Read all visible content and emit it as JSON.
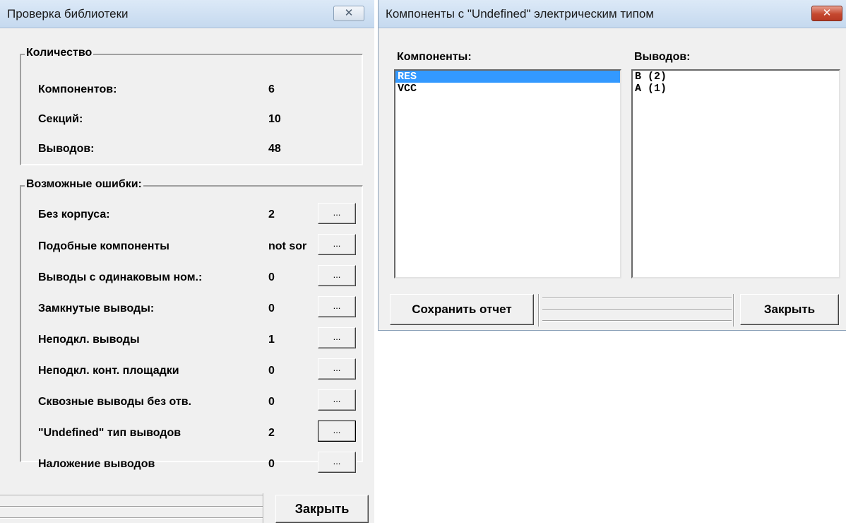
{
  "library_check": {
    "title": "Проверка библиотеки",
    "close_glyph": "✕",
    "quantity_group": {
      "title": "Количество",
      "rows": [
        {
          "label": "Компонентов:",
          "value": "6"
        },
        {
          "label": "Секций:",
          "value": "10"
        },
        {
          "label": "Выводов:",
          "value": "48"
        }
      ]
    },
    "errors_group": {
      "title": "Возможные ошибки:",
      "rows": [
        {
          "label": "Без корпуса:",
          "value": "2",
          "button": "..."
        },
        {
          "label": "Подобные компоненты",
          "value": "not sor",
          "button": "..."
        },
        {
          "label": "Выводы с одинаковым ном.:",
          "value": "0",
          "button": "..."
        },
        {
          "label": "Замкнутые выводы:",
          "value": "0",
          "button": "..."
        },
        {
          "label": "Неподкл. выводы",
          "value": "1",
          "button": "..."
        },
        {
          "label": "Неподкл. конт. площадки",
          "value": "0",
          "button": "..."
        },
        {
          "label": "Сквозные выводы без отв.",
          "value": "0",
          "button": "..."
        },
        {
          "label": "\"Undefined\" тип выводов",
          "value": "2",
          "button": "..."
        },
        {
          "label": "Наложение выводов",
          "value": "0",
          "button": "..."
        }
      ]
    },
    "close_button": "Закрыть"
  },
  "undefined_components": {
    "title": "Компоненты с \"Undefined\" электрическим типом",
    "close_glyph": "✕",
    "components_label": "Компоненты:",
    "pins_label": "Выводов:",
    "components": [
      {
        "name": "RES",
        "selected": true
      },
      {
        "name": "VCC",
        "selected": false
      }
    ],
    "pins": [
      "B (2)",
      "A (1)"
    ],
    "save_button": "Сохранить отчет",
    "close_button": "Закрыть"
  },
  "colors": {
    "selection": "#3399ff",
    "dialog_background": "#f0f0f0",
    "title_bar": "#c5d9ef",
    "close_button_active": "#c5482f"
  }
}
